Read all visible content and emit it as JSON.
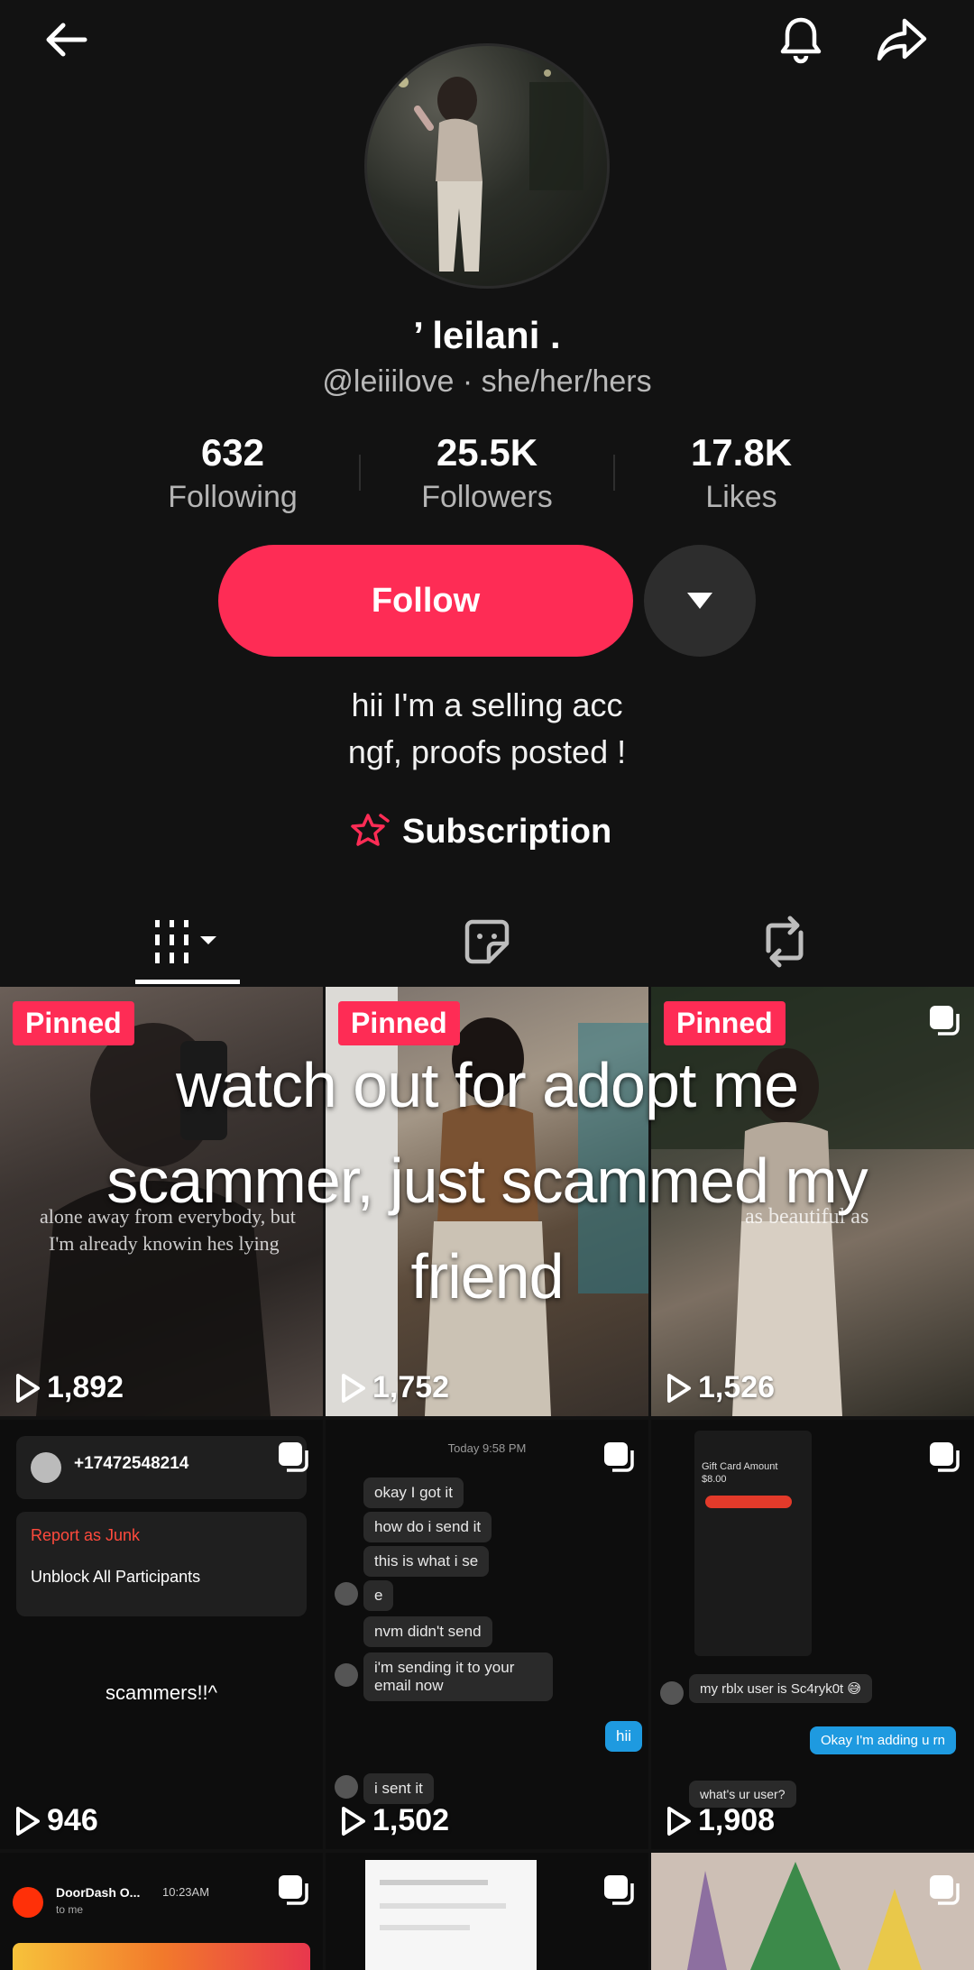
{
  "profile": {
    "display_name": "’ leilani .",
    "handle_line": "@leiiilove · she/her/hers",
    "stats": [
      {
        "value": "632",
        "label": "Following"
      },
      {
        "value": "25.5K",
        "label": "Followers"
      },
      {
        "value": "17.8K",
        "label": "Likes"
      }
    ],
    "follow_label": "Follow",
    "bio_line1": "hii I'm a selling acc",
    "bio_line2": "ngf, proofs posted !",
    "subscription_label": "Subscription"
  },
  "colors": {
    "accent": "#fe2c55",
    "background": "#121212"
  },
  "icons": [
    "back-arrow-icon",
    "bell-icon",
    "share-icon",
    "dropdown-caret-icon",
    "subscription-star-icon",
    "videos-grid-icon",
    "stickers-icon",
    "repost-icon",
    "play-icon",
    "multi-photo-icon"
  ],
  "overlay_caption": {
    "line1": "watch out for adopt me",
    "line2": "scammer, just scammed my",
    "line3": "friend"
  },
  "videos": [
    {
      "pinned": "Pinned",
      "views": "1,892",
      "faded_line1": "alone away from everybody, but",
      "faded_line2": "I'm already knowin hes lying"
    },
    {
      "pinned": "Pinned",
      "views": "1,752"
    },
    {
      "pinned": "Pinned",
      "views": "1,526",
      "faded_line1": "as beautiful as"
    },
    {
      "views": "946",
      "phone": "+17472548214",
      "report": "Report as Junk",
      "unblock": "Unblock All Participants",
      "caption": "scammers!!^"
    },
    {
      "views": "1,502",
      "timestamp": "Today 9:58 PM",
      "msgs": [
        "okay I got it",
        "how do i send it",
        "this is what i se",
        "e",
        "nvm didn't send",
        "i'm sending it to your email now",
        "i sent it"
      ],
      "blue": "hii"
    },
    {
      "views": "1,908",
      "card_title": "Gift Card Amount",
      "card_amount": "$8.00",
      "msg1": "my rblx user is Sc4ryk0t 😅",
      "blue": "Okay I'm adding u rn",
      "msg2": "what's ur user?"
    },
    {
      "sender": "DoorDash O...",
      "time": "10:23AM",
      "to": "to me"
    },
    {},
    {}
  ]
}
